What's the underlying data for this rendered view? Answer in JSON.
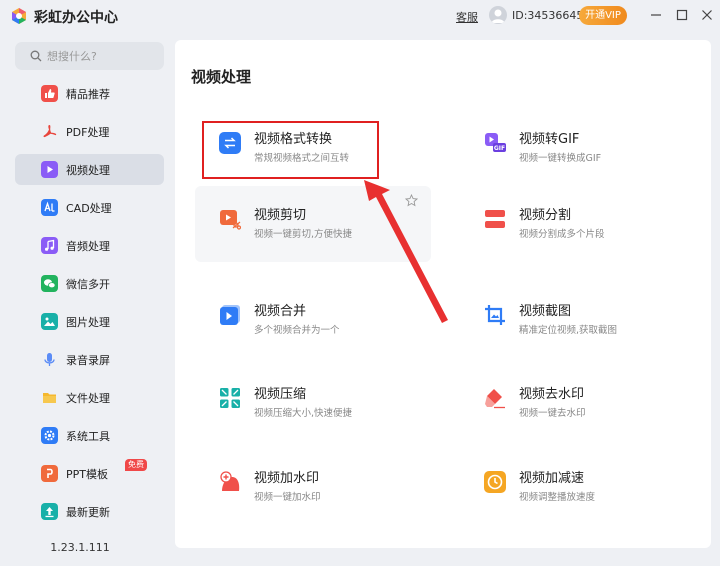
{
  "app": {
    "title": "彩虹办公中心",
    "support_label": "客服",
    "user_id": "ID:34536645",
    "vip_button": "开通VIP",
    "logo_icon": "rainbow-logo-icon",
    "window_controls": [
      "minimize-icon",
      "maximize-icon",
      "close-icon"
    ]
  },
  "sidebar": {
    "search_placeholder": "想搜什么?",
    "items": [
      {
        "label": "精品推荐",
        "icon": "thumbs-up-icon",
        "color": "#f0504a"
      },
      {
        "label": "PDF处理",
        "icon": "pdf-icon",
        "color": "#e8453c"
      },
      {
        "label": "视频处理",
        "icon": "video-play-icon",
        "color": "#8a5cf6",
        "active": true
      },
      {
        "label": "CAD处理",
        "icon": "cad-icon",
        "color": "#2f7cf6"
      },
      {
        "label": "音频处理",
        "icon": "music-icon",
        "color": "#8a5cf6"
      },
      {
        "label": "微信多开",
        "icon": "wechat-icon",
        "color": "#22b35e"
      },
      {
        "label": "图片处理",
        "icon": "image-icon",
        "color": "#18b0a8"
      },
      {
        "label": "录音录屏",
        "icon": "microphone-icon",
        "color": "#5b8cf6"
      },
      {
        "label": "文件处理",
        "icon": "folder-icon",
        "color": "#f5b82e"
      },
      {
        "label": "系统工具",
        "icon": "gear-icon",
        "color": "#2f7cf6"
      },
      {
        "label": "PPT模板",
        "icon": "ppt-icon",
        "color": "#f06a3c",
        "badge": "免费"
      },
      {
        "label": "最新更新",
        "icon": "upload-icon",
        "color": "#18b0a8"
      }
    ],
    "version": "1.23.1.111"
  },
  "main": {
    "section_title": "视频处理",
    "tools": [
      {
        "title": "视频格式转换",
        "desc": "常规视频格式之间互转",
        "icon": "convert-arrows-icon",
        "color": "#2f7cf6",
        "highlighted": true
      },
      {
        "title": "视频转GIF",
        "desc": "视频一键转换成GIF",
        "icon": "gif-icon",
        "color": "#8a5cf6"
      },
      {
        "title": "视频剪切",
        "desc": "视频一键剪切,方便快捷",
        "icon": "scissors-icon",
        "color": "#f06a3c"
      },
      {
        "title": "视频分割",
        "desc": "视频分割成多个片段",
        "icon": "split-icon",
        "color": "#f0504a"
      },
      {
        "title": "视频合并",
        "desc": "多个视频合并为一个",
        "icon": "merge-video-icon",
        "color": "#2f7cf6"
      },
      {
        "title": "视频截图",
        "desc": "精准定位视频,获取截图",
        "icon": "crop-icon",
        "color": "#2f7cf6"
      },
      {
        "title": "视频压缩",
        "desc": "视频压缩大小,快速便捷",
        "icon": "compress-icon",
        "color": "#18b0a8"
      },
      {
        "title": "视频去水印",
        "desc": "视频一键去水印",
        "icon": "eraser-icon",
        "color": "#f0504a"
      },
      {
        "title": "视频加水印",
        "desc": "视频一键加水印",
        "icon": "add-watermark-icon",
        "color": "#f0504a"
      },
      {
        "title": "视频加减速",
        "desc": "视频调整播放速度",
        "icon": "speed-clock-icon",
        "color": "#f5a623"
      }
    ]
  }
}
